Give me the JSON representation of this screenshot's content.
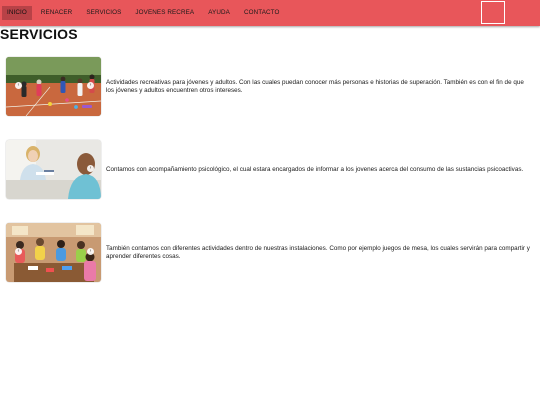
{
  "nav": {
    "items": [
      {
        "label": "INICIO"
      },
      {
        "label": "RENACER"
      },
      {
        "label": "SERVICIOS"
      },
      {
        "label": "JOVENES RECREA"
      },
      {
        "label": "AYUDA"
      },
      {
        "label": "CONTACTO"
      }
    ]
  },
  "page": {
    "title": "SERVICIOS"
  },
  "services": [
    {
      "text": "Actividades recreativas para jóvenes y adultos. Con las cuales puedan conocer más personas e historias de superación. También es con el fin de que los jóvenes y adultos encuentren otros intereses."
    },
    {
      "text": "Contamos con acompañamiento psicológico, el cual estara encargados de informar a los jovenes acerca del consumo de las sustancias psicoactivas."
    },
    {
      "text": "También contamos con diferentes actividades dentro de nuestras instalaciones. Como por ejemplo juegos de mesa, los cuales servirán para compartir y aprender diferentes cosas."
    }
  ],
  "carousel": {
    "prev_icon": "‹",
    "next_icon": "›"
  },
  "colors": {
    "navbar": "#e8565a",
    "nav_active": "#b84247"
  }
}
